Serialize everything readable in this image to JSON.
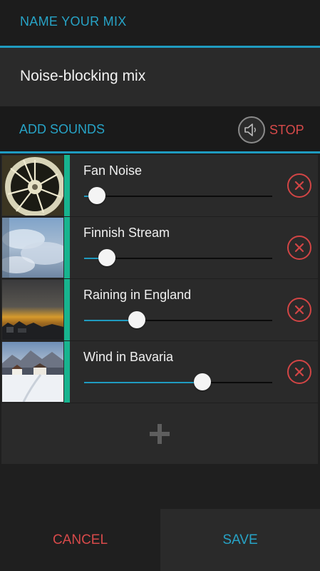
{
  "header": {
    "title": "NAME YOUR MIX"
  },
  "mix": {
    "name": "Noise-blocking mix"
  },
  "toolbar": {
    "add_sounds_label": "ADD SOUNDS",
    "stop_label": "STOP"
  },
  "sounds": [
    {
      "name": "Fan Noise",
      "volume_fraction": 0.07
    },
    {
      "name": "Finnish Stream",
      "volume_fraction": 0.12
    },
    {
      "name": "Raining in England",
      "volume_fraction": 0.28
    },
    {
      "name": "Wind in Bavaria",
      "volume_fraction": 0.63
    }
  ],
  "footer": {
    "cancel_label": "CANCEL",
    "save_label": "SAVE"
  },
  "icons": {
    "stop": "speaker-icon",
    "remove": "close-circle-icon",
    "add": "plus-icon"
  },
  "colors": {
    "accent_blue": "#27a3c6",
    "accent_red": "#d74a4a",
    "accent_green": "#18b48f",
    "background": "#1f1f1f",
    "row_background": "#2a2a2a"
  }
}
